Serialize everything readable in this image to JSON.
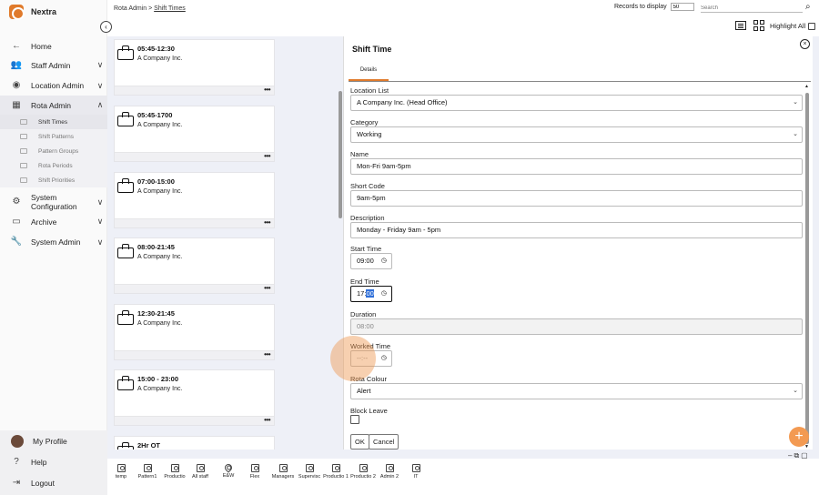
{
  "app": {
    "name": "Nextra"
  },
  "sidebar": {
    "items": [
      {
        "label": "Home",
        "icon": "arrow-left-icon",
        "chevron": ""
      },
      {
        "label": "Staff Admin",
        "icon": "users-icon",
        "chevron": "∨"
      },
      {
        "label": "Location Admin",
        "icon": "location-icon",
        "chevron": "∨"
      },
      {
        "label": "Rota Admin",
        "icon": "calendar-icon",
        "chevron": "∧"
      }
    ],
    "sub_items": [
      {
        "label": "Shift Times"
      },
      {
        "label": "Shift Patterns"
      },
      {
        "label": "Pattern Groups"
      },
      {
        "label": "Rota Periods"
      },
      {
        "label": "Shift Priorities"
      }
    ],
    "items_after": [
      {
        "label": "System Configuration",
        "icon": "gear-icon",
        "chevron": "∨"
      },
      {
        "label": "Archive",
        "icon": "archive-icon",
        "chevron": "∨"
      },
      {
        "label": "System Admin",
        "icon": "wrench-icon",
        "chevron": "∨"
      }
    ],
    "bottom": [
      {
        "label": "My Profile"
      },
      {
        "label": "Help"
      },
      {
        "label": "Logout"
      }
    ]
  },
  "header": {
    "breadcrumb_root": "Rota Admin",
    "breadcrumb_sep": " > ",
    "breadcrumb_current": "Shift Times",
    "records_label": "Records to display",
    "records_value": "50",
    "search_placeholder": "Search",
    "highlight_label": "Highlight All"
  },
  "cards": [
    {
      "title": "05:45-12:30",
      "company": "A Company Inc."
    },
    {
      "title": "05:45-1700",
      "company": "A Company Inc."
    },
    {
      "title": "07:00-15:00",
      "company": "A Company Inc."
    },
    {
      "title": "08:00-21:45",
      "company": "A Company Inc."
    },
    {
      "title": "12:30-21:45",
      "company": "A Company Inc."
    },
    {
      "title": "15:00 - 23:00",
      "company": "A Company Inc."
    },
    {
      "title": "2Hr OT",
      "company": ""
    }
  ],
  "panel": {
    "title": "Shift Time",
    "tab": "Details",
    "fields": {
      "location_label": "Location List",
      "location_value": "A Company Inc. (Head Office)",
      "category_label": "Category",
      "category_value": "Working",
      "name_label": "Name",
      "name_value": "Mon-Fri 9am-5pm",
      "short_code_label": "Short Code",
      "short_code_value": "9am-5pm",
      "description_label": "Description",
      "description_value": "Monday - Friday 9am - 5pm",
      "start_label": "Start Time",
      "start_value": "09:00",
      "end_label": "End Time",
      "end_hour": "17:",
      "end_min": "00",
      "duration_label": "Duration",
      "duration_value": "08:00",
      "worked_label": "Worked Time",
      "worked_value": "--:--",
      "colour_label": "Rota Colour",
      "colour_value": "Alert",
      "block_label": "Block Leave"
    },
    "ok_label": "OK",
    "cancel_label": "Cancel"
  },
  "bottom_tabs": [
    {
      "label": "temp"
    },
    {
      "label": "Pattern1"
    },
    {
      "label": "Productio"
    },
    {
      "label": "All staff"
    },
    {
      "label": "E&W"
    },
    {
      "label": "Flex"
    },
    {
      "label": "Managers"
    },
    {
      "label": "Supervisc"
    },
    {
      "label": "Productio 1"
    },
    {
      "label": "Productio 2"
    },
    {
      "label": "Admin 2"
    },
    {
      "label": "IT"
    }
  ],
  "colors": {
    "accent": "#e07a2b",
    "fab": "#f39a52",
    "selection": "#2f6fd8"
  }
}
